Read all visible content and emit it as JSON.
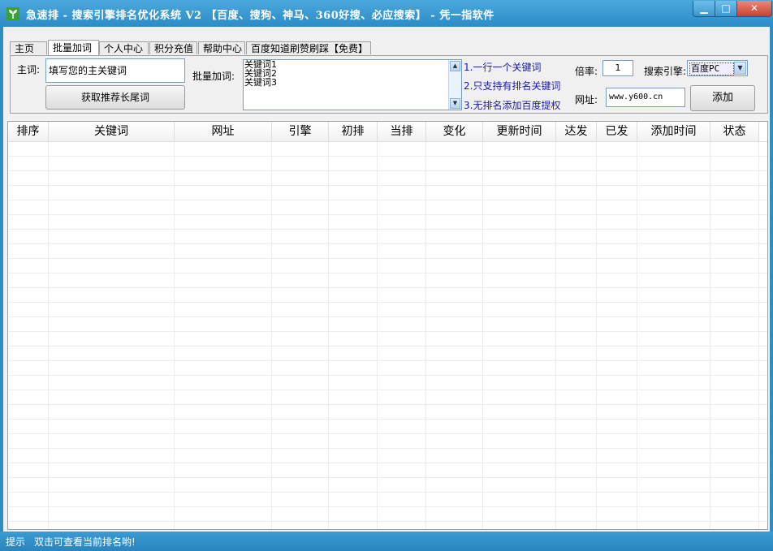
{
  "window": {
    "title": "急速排 - 搜索引擎排名优化系统 V2 【百度、搜狗、神马、360好搜、必应搜索】 - 凭一指软件",
    "minimize": "▁",
    "maximize": "□",
    "close": "✕"
  },
  "tabs": [
    "主页",
    "批量加词",
    "个人中心",
    "积分充值",
    "帮助中心",
    "百度知道刷赞刷踩【免费】"
  ],
  "form": {
    "main_word_label": "主词:",
    "main_word_value": "填写您的主关键词",
    "fetch_button": "获取推荐长尾词",
    "batch_label": "批量加词:",
    "batch_lines": [
      "关键词1",
      "关键词2",
      "关键词3"
    ],
    "hints": [
      "1.一行一个关键词",
      "2.只支持有排名关键词",
      "3.无排名添加百度提权"
    ],
    "rate_label": "倍率:",
    "rate_value": "1",
    "engine_label": "搜索引擎:",
    "engine_value": "百度PC",
    "url_label": "网址:",
    "url_value": "www.y600.cn",
    "add_button": "添加"
  },
  "grid": {
    "columns": [
      "排序",
      "关键词",
      "网址",
      "引擎",
      "初排",
      "当排",
      "变化",
      "更新时间",
      "达发",
      "已发",
      "添加时间",
      "状态"
    ]
  },
  "status": {
    "label": "提示",
    "message": "双击可查看当前排名哟!"
  }
}
